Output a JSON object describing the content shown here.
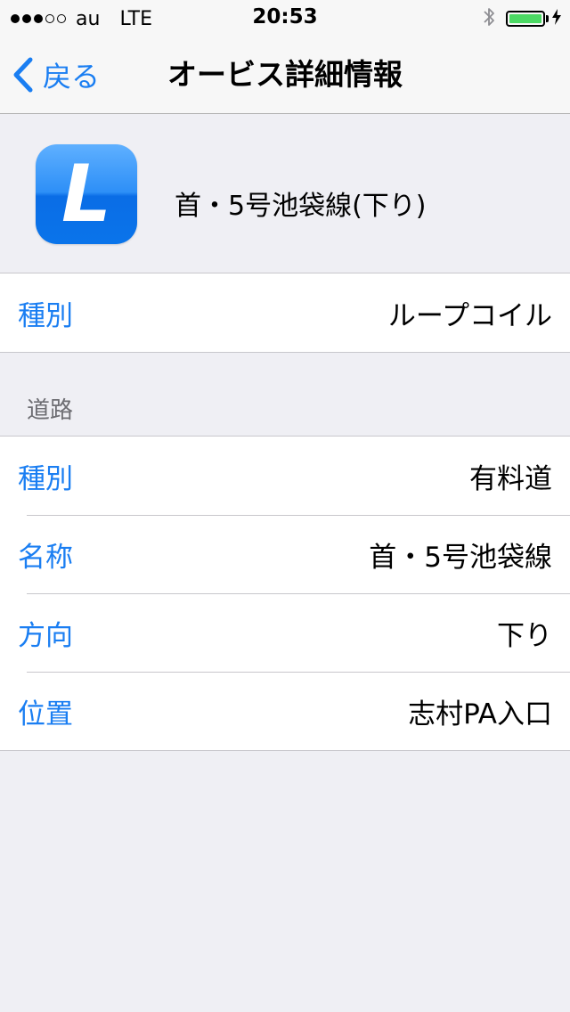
{
  "status_bar": {
    "carrier": "au",
    "network": "LTE",
    "time": "20:53",
    "signal_bars_filled": 3,
    "signal_bars_total": 5,
    "battery_level": 1.0,
    "battery_color": "#4cd964"
  },
  "nav": {
    "back_label": "戻る",
    "title": "オービス詳細情報"
  },
  "header": {
    "icon_letter": "L",
    "title": "首・5号池袋線(下り)"
  },
  "type_section": {
    "rows": [
      {
        "label": "種別",
        "value": "ループコイル"
      }
    ]
  },
  "road_section": {
    "header": "道路",
    "rows": [
      {
        "label": "種別",
        "value": "有料道"
      },
      {
        "label": "名称",
        "value": "首・5号池袋線"
      },
      {
        "label": "方向",
        "value": "下り"
      },
      {
        "label": "位置",
        "value": "志村PA入口"
      }
    ]
  },
  "colors": {
    "accent": "#1a7ef2",
    "background": "#efeff4",
    "separator": "#c8c7cc"
  }
}
